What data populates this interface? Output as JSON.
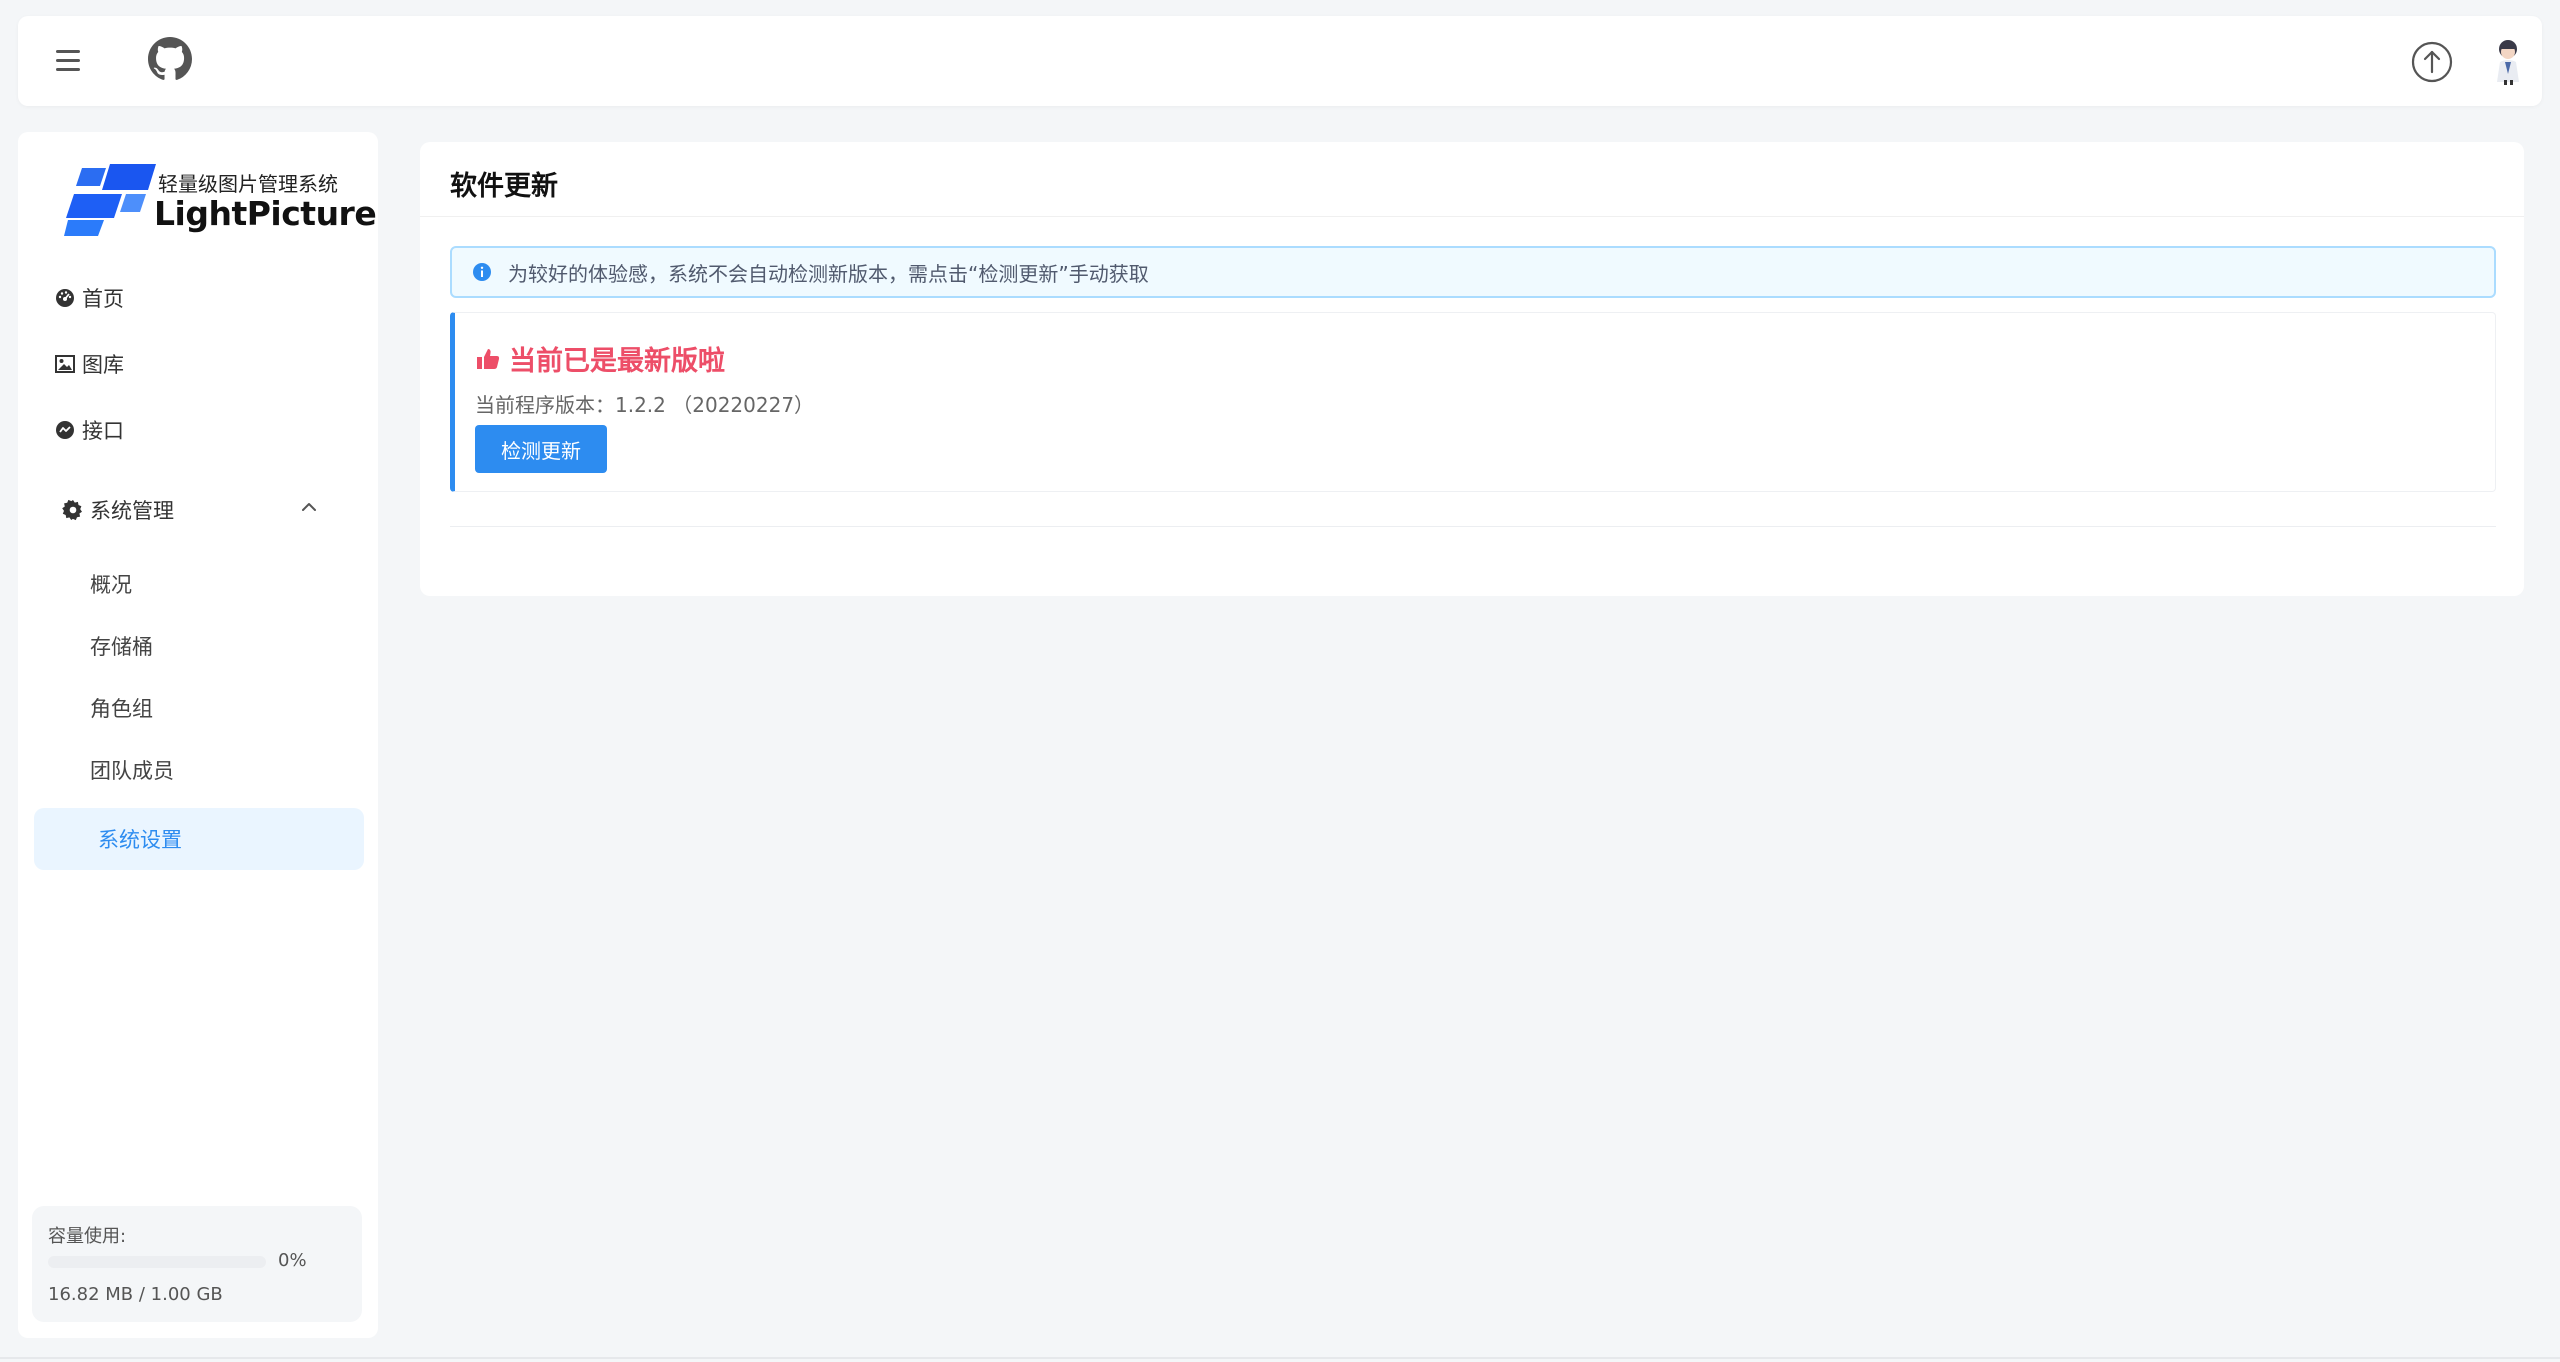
{
  "header": {
    "menu_icon": "hamburger-menu-icon",
    "github_icon": "github-icon",
    "upload_icon": "upload-arrow-icon",
    "avatar_icon": "user-avatar"
  },
  "sidebar": {
    "logo": {
      "subtitle": "轻量级图片管理系统",
      "title": "LightPicture"
    },
    "items": [
      {
        "label": "首页",
        "icon": "dashboard-icon"
      },
      {
        "label": "图库",
        "icon": "image-icon"
      },
      {
        "label": "接口",
        "icon": "api-icon"
      },
      {
        "label": "系统管理",
        "icon": "gear-icon",
        "expanded": true
      }
    ],
    "sub_items": [
      {
        "label": "概况"
      },
      {
        "label": "存储桶"
      },
      {
        "label": "角色组"
      },
      {
        "label": "团队成员"
      },
      {
        "label": "系统设置",
        "active": true
      }
    ],
    "storage": {
      "label": "容量使用:",
      "percent_text": "0%",
      "percent": 0,
      "used_text": "16.82 MB / 1.00 GB"
    }
  },
  "main": {
    "title": "软件更新",
    "alert": "为较好的体验感，系统不会自动检测新版本，需点击“检测更新”手动获取",
    "status_title": "当前已是最新版啦",
    "version_text": "当前程序版本：1.2.2 （20220227）",
    "check_button": "检测更新"
  },
  "colors": {
    "accent": "#2d8cf0",
    "status_red": "#ed4e68",
    "active_bg": "#eaf5ff",
    "alert_bg": "#f0faff",
    "alert_border": "#abdcff"
  }
}
